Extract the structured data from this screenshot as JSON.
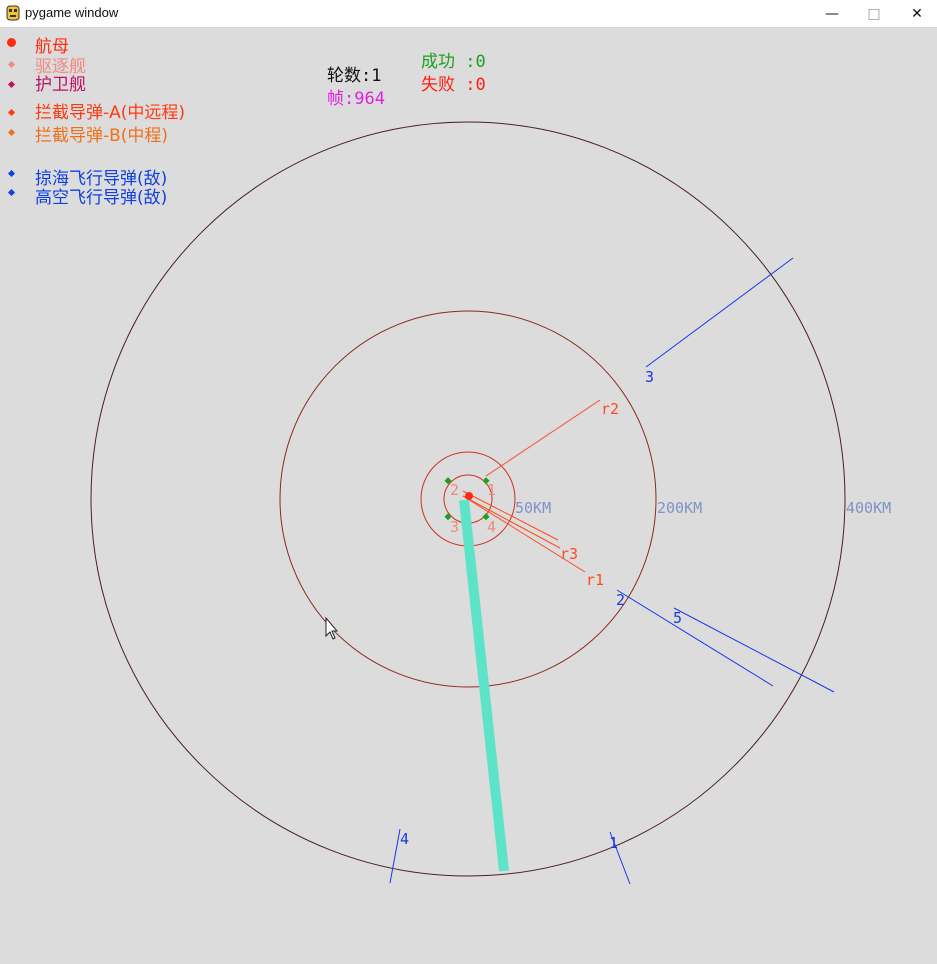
{
  "window": {
    "title": "pygame window",
    "minimize": "—",
    "maximize": "□",
    "close": "✕"
  },
  "legend": [
    {
      "label": "航母",
      "color": "#ff2a10",
      "marker": "dot"
    },
    {
      "label": "驱逐舰",
      "color": "#f08a80",
      "marker": "diamond"
    },
    {
      "label": "护卫舰",
      "color": "#c01060",
      "marker": "diamond"
    },
    {
      "label": "拦截导弹-A(中远程)",
      "color": "#ff3a10",
      "marker": "diamond"
    },
    {
      "label": "拦截导弹-B(中程)",
      "color": "#f07018",
      "marker": "diamond"
    },
    {
      "label": "掠海飞行导弹(敌)",
      "color": "#1040e0",
      "marker": "diamond"
    },
    {
      "label": "高空飞行导弹(敌)",
      "color": "#1040e0",
      "marker": "diamond"
    }
  ],
  "hud": {
    "rounds": "轮数:1",
    "frame": "帧:964",
    "success": "成功 :0",
    "fail": "失败 :0"
  },
  "colors": {
    "rounds": "#111111",
    "frame": "#e020e0",
    "success": "#20a020",
    "fail": "#ff2010",
    "range": "#7e93c8",
    "enemy": "#1838e8",
    "laser": "#5de4c8"
  },
  "range_labels": [
    "50KM",
    "200KM",
    "400KM"
  ],
  "radar_labels": [
    "r1",
    "r2",
    "r3"
  ],
  "escort_labels": [
    "1",
    "2",
    "3",
    "4"
  ],
  "enemy_labels": [
    "1",
    "2",
    "3",
    "4",
    "5"
  ]
}
